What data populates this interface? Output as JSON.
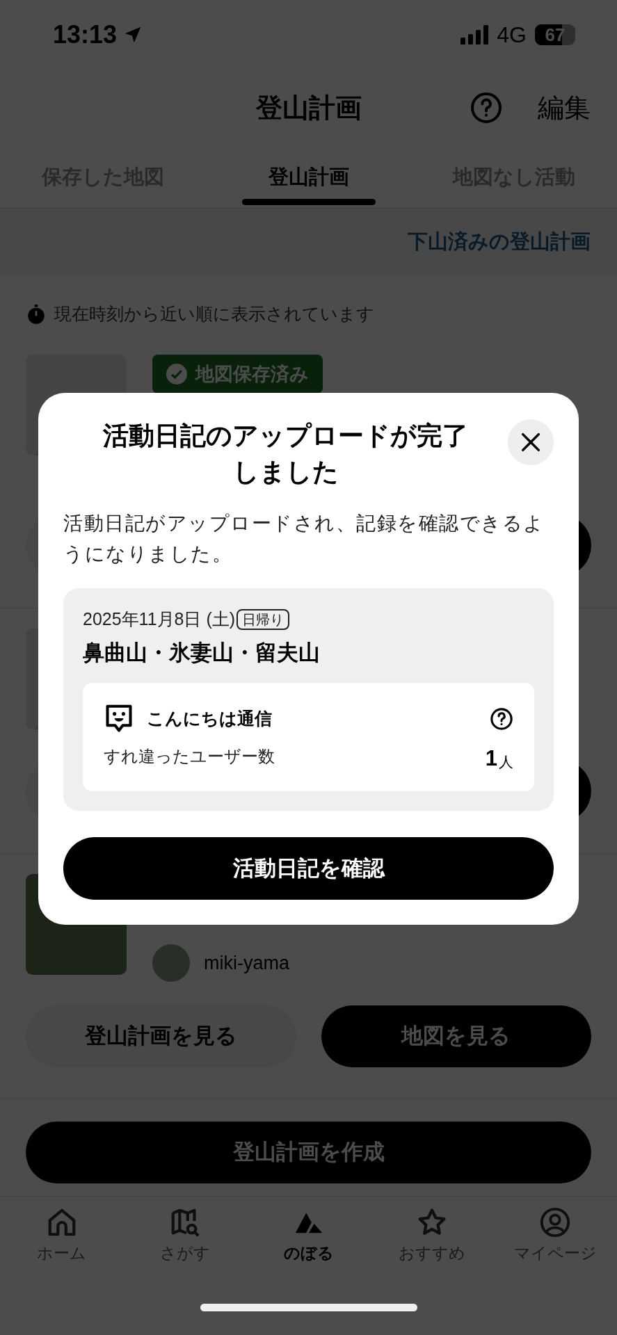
{
  "status_bar": {
    "time": "13:13",
    "network": "4G",
    "battery": "67"
  },
  "header": {
    "title": "登山計画",
    "edit": "編集"
  },
  "tabs": [
    {
      "label": "保存した地図",
      "selected": false
    },
    {
      "label": "登山計画",
      "selected": true
    },
    {
      "label": "地図なし活動",
      "selected": false
    }
  ],
  "past_plans_link": "下山済みの登山計画",
  "sort_note": "現在時刻から近い順に表示されています",
  "plans": [
    {
      "kind": "placeholder",
      "badge": "地図保存済み"
    },
    {
      "kind": "placeholder"
    },
    {
      "kind": "photo",
      "author": "miki-yama",
      "buttons": [
        "登山計画を見る",
        "地図を見る"
      ]
    }
  ],
  "create_button": "登山計画を作成",
  "tab_bar": [
    {
      "label": "ホーム",
      "selected": false
    },
    {
      "label": "さがす",
      "selected": false
    },
    {
      "label": "のぼる",
      "selected": true
    },
    {
      "label": "おすすめ",
      "selected": false
    },
    {
      "label": "マイページ",
      "selected": false
    }
  ],
  "dialog": {
    "title": "活動日記のアップロードが完了しました",
    "message": "活動日記がアップロードされ、記録を確認できるようになりました。",
    "activity": {
      "date": "2025年11月8日 (土)",
      "type": "日帰り",
      "name": "鼻曲山・氷妻山・留夫山",
      "greeting": {
        "title": "こんにちは通信",
        "label": "すれ違ったユーザー数",
        "count": "1",
        "unit": "人"
      }
    },
    "button": "活動日記を確認"
  }
}
